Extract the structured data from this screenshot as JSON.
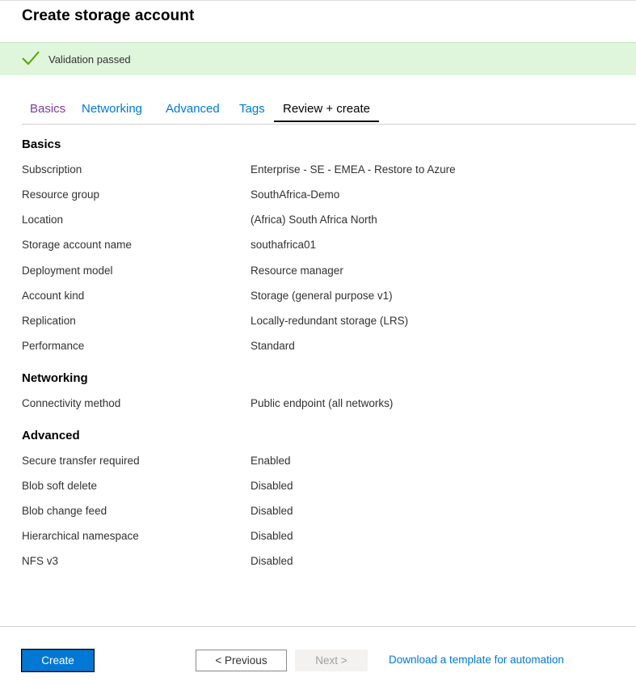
{
  "page": {
    "title": "Create storage account"
  },
  "validation": {
    "icon": "checkmark-icon",
    "text": "Validation passed",
    "color": "#dff6dd",
    "icon_color": "#57a300"
  },
  "tabs": [
    {
      "label": "Basics",
      "state": "visited"
    },
    {
      "label": "Networking",
      "state": "default"
    },
    {
      "label": "Advanced",
      "state": "default"
    },
    {
      "label": "Tags",
      "state": "default"
    },
    {
      "label": "Review + create",
      "state": "active"
    }
  ],
  "sections": {
    "basics": {
      "heading": "Basics",
      "rows": [
        {
          "label": "Subscription",
          "value": "Enterprise - SE - EMEA - Restore to Azure"
        },
        {
          "label": "Resource group",
          "value": "SouthAfrica-Demo"
        },
        {
          "label": "Location",
          "value": "(Africa) South Africa North"
        },
        {
          "label": "Storage account name",
          "value": "southafrica01"
        },
        {
          "label": "Deployment model",
          "value": "Resource manager"
        },
        {
          "label": "Account kind",
          "value": "Storage (general purpose v1)"
        },
        {
          "label": "Replication",
          "value": "Locally-redundant storage (LRS)"
        },
        {
          "label": "Performance",
          "value": "Standard"
        }
      ]
    },
    "networking": {
      "heading": "Networking",
      "rows": [
        {
          "label": "Connectivity method",
          "value": "Public endpoint (all networks)"
        }
      ]
    },
    "advanced": {
      "heading": "Advanced",
      "rows": [
        {
          "label": "Secure transfer required",
          "value": "Enabled"
        },
        {
          "label": "Blob soft delete",
          "value": "Disabled"
        },
        {
          "label": "Blob change feed",
          "value": "Disabled"
        },
        {
          "label": "Hierarchical namespace",
          "value": "Disabled"
        },
        {
          "label": "NFS v3",
          "value": "Disabled"
        }
      ]
    }
  },
  "footer": {
    "create_label": "Create",
    "previous_label": "< Previous",
    "next_label": "Next >",
    "next_enabled": false,
    "download_link": "Download a template for automation",
    "accent": "#0078d4"
  }
}
